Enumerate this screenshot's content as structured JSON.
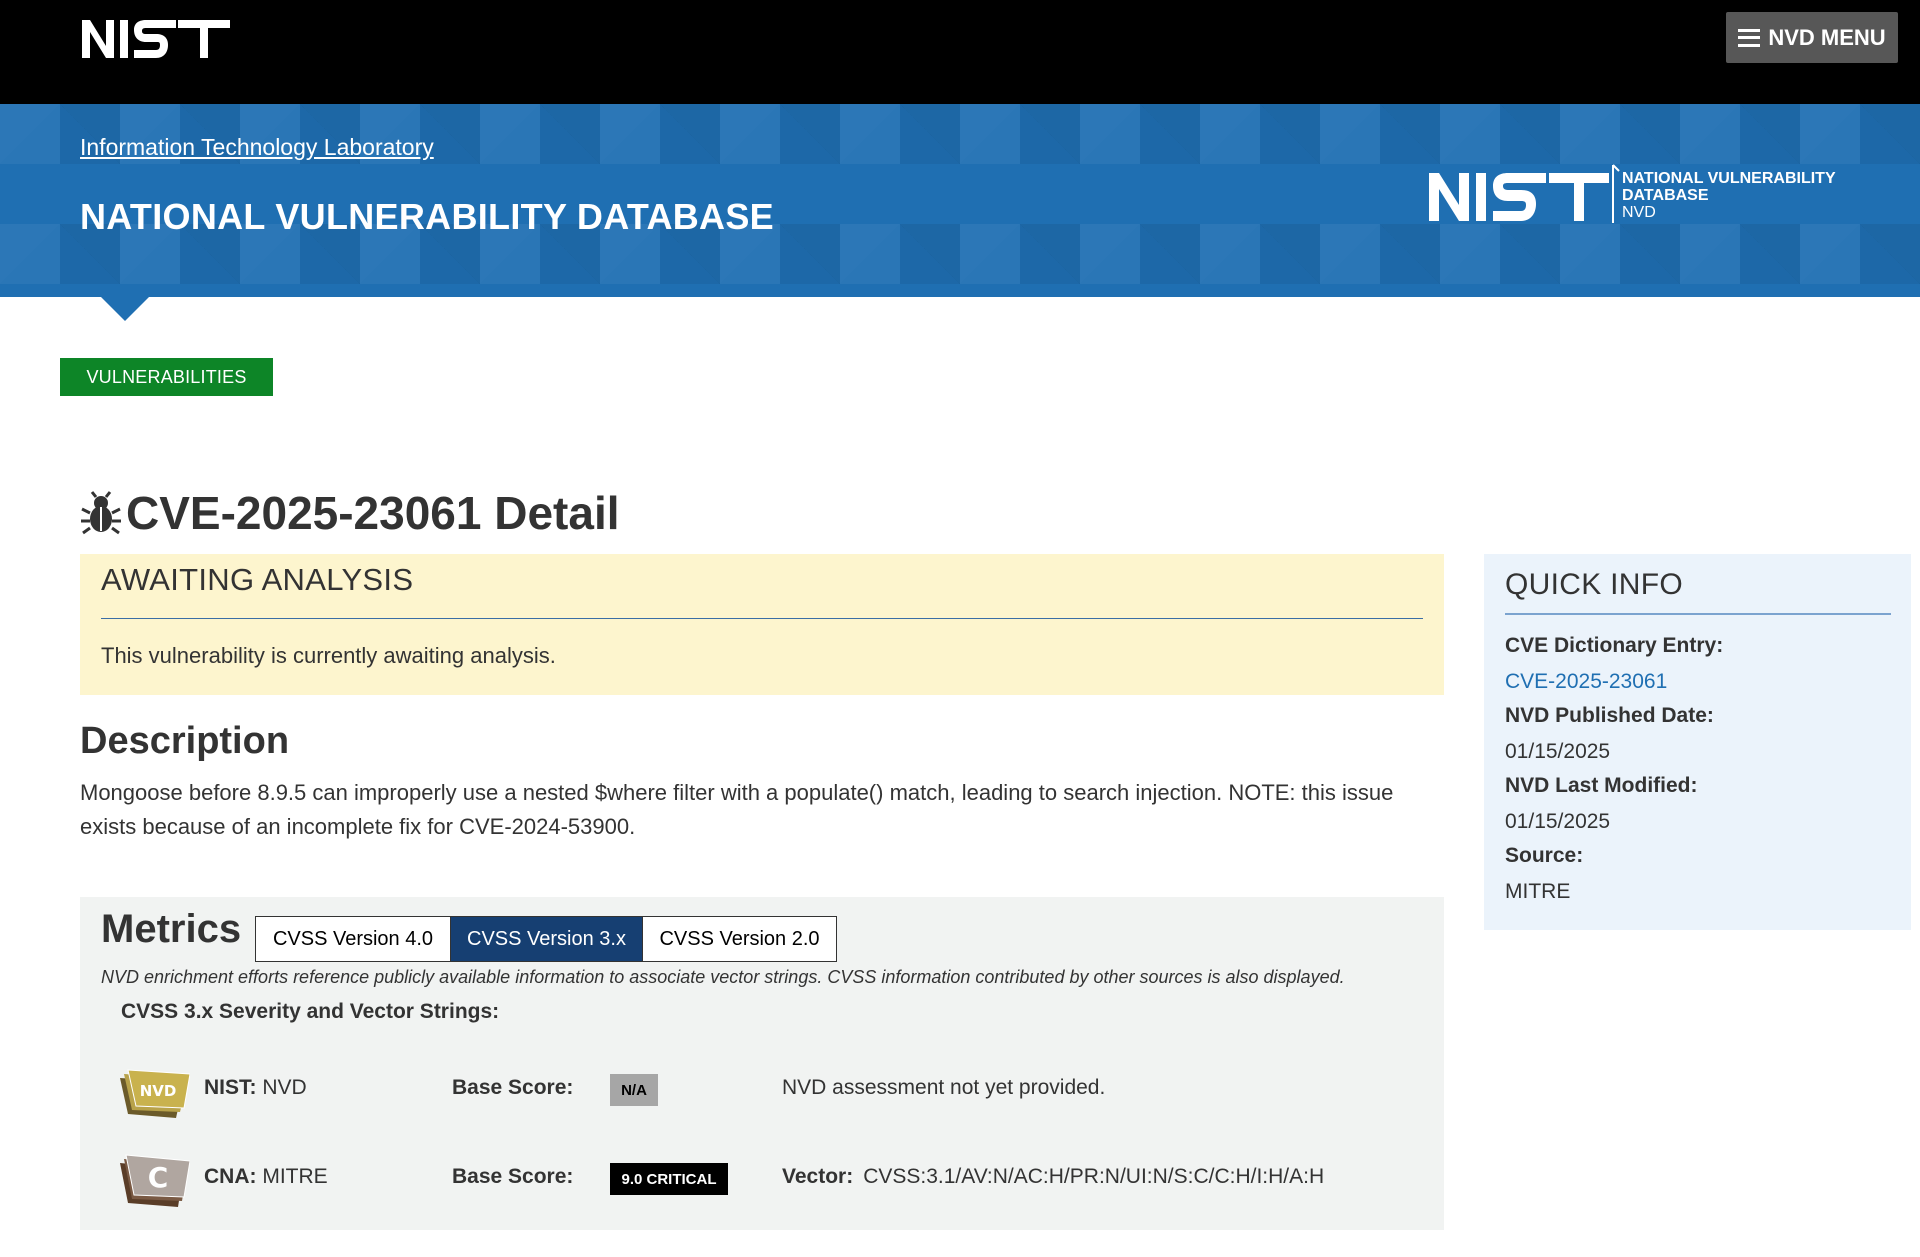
{
  "header": {
    "logo_text": "NIST",
    "menu_label": "NVD MENU"
  },
  "banner": {
    "lab_link": "Information Technology Laboratory",
    "title": "NATIONAL VULNERABILITY DATABASE",
    "logo_line1": "NATIONAL VULNERABILITY",
    "logo_line2": "DATABASE",
    "logo_line3": "NVD"
  },
  "section_tag": "VULNERABILITIES",
  "page": {
    "title": "CVE-2025-23061 Detail"
  },
  "status": {
    "heading": "AWAITING ANALYSIS",
    "message": "This vulnerability is currently awaiting analysis."
  },
  "description": {
    "heading": "Description",
    "text": "Mongoose before 8.9.5 can improperly use a nested $where filter with a populate() match, leading to search injection. NOTE: this issue exists because of an incomplete fix for CVE-2024-53900."
  },
  "metrics": {
    "heading": "Metrics",
    "tabs": [
      {
        "label": "CVSS Version 4.0",
        "active": false
      },
      {
        "label": "CVSS Version 3.x",
        "active": true
      },
      {
        "label": "CVSS Version 2.0",
        "active": false
      }
    ],
    "note": "NVD enrichment efforts reference publicly available information to associate vector strings. CVSS information contributed by other sources is also displayed.",
    "severity_heading": "CVSS 3.x Severity and Vector Strings:",
    "rows": [
      {
        "source_label": "NIST:",
        "source_value": "NVD",
        "base_label": "Base Score:",
        "score": "N/A",
        "detail": "NVD assessment not yet provided."
      },
      {
        "source_label": "CNA:",
        "source_value": "MITRE",
        "base_label": "Base Score:",
        "score": "9.0 CRITICAL",
        "vector_label": "Vector:",
        "vector": "CVSS:3.1/AV:N/AC:H/PR:N/UI:N/S:C/C:H/I:H/A:H"
      }
    ]
  },
  "quick_info": {
    "heading": "QUICK INFO",
    "items": [
      {
        "label": "CVE Dictionary Entry:",
        "value": "CVE-2025-23061"
      },
      {
        "label": "NVD Published Date:",
        "value": "01/15/2025"
      },
      {
        "label": "NVD Last Modified:",
        "value": "01/15/2025"
      },
      {
        "label": "Source:",
        "value": "MITRE"
      }
    ]
  },
  "colors": {
    "banner_blue": "#1f6fb2",
    "tag_green": "#0d8527",
    "active_tab": "#163f72",
    "awaiting_bg": "#fdf5ce",
    "quick_info_bg": "#ebf3fb",
    "critical": "#000000"
  },
  "icons": [
    "menu-icon",
    "nist-logo",
    "nvd-logo",
    "bug-icon",
    "nvd-badge-icon",
    "cna-badge-icon"
  ]
}
